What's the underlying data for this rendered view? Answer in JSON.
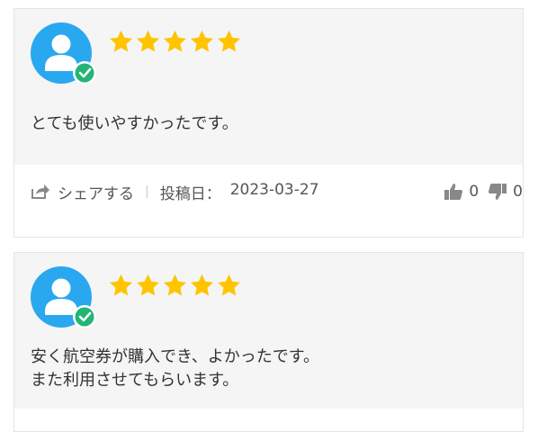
{
  "colors": {
    "star": "#FFC400",
    "avatar_bg": "#29A8F0",
    "verified": "#22B573",
    "card_bg": "#F5F5F5",
    "icon_gray": "#888888"
  },
  "icons": {
    "avatar": "user-avatar-icon",
    "verified": "check-badge-icon",
    "star": "star-icon",
    "share": "share-icon",
    "like": "thumbs-up-icon",
    "dislike": "thumbs-down-icon"
  },
  "reviews": [
    {
      "rating": 5,
      "text": "とても使いやすかったです。",
      "share_label": "シェアする",
      "posted_label": "投稿日：",
      "posted_date": "2023-03-27",
      "likes": "0",
      "dislikes": "0"
    },
    {
      "rating": 5,
      "text": "安く航空券が購入でき、よかったです。\nまた利用させてもらいます。"
    }
  ]
}
